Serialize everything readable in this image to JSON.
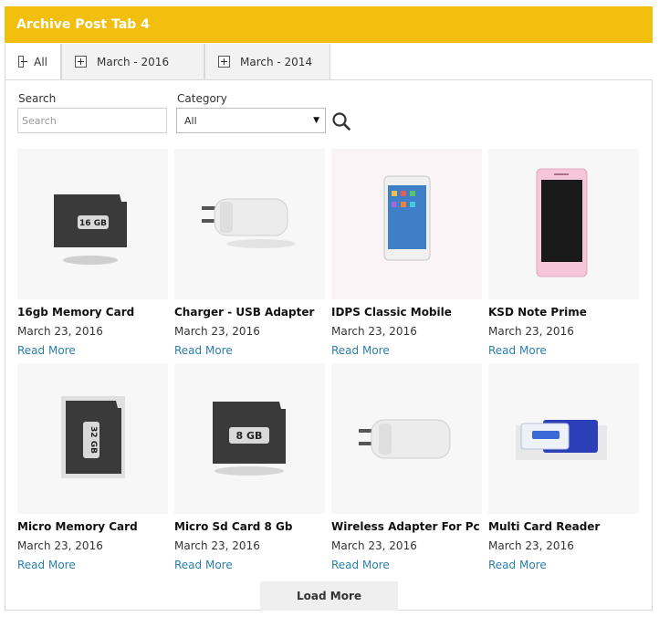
{
  "widget": {
    "title": "Archive Post Tab 4"
  },
  "tabs": [
    {
      "label": "All",
      "state": "expanded"
    },
    {
      "label": "March - 2016",
      "state": "collapsed"
    },
    {
      "label": "March - 2014",
      "state": "collapsed"
    }
  ],
  "filters": {
    "search_label": "Search",
    "search_placeholder": "Search",
    "category_label": "Category",
    "category_value": "All"
  },
  "products": [
    {
      "title": "16gb Memory Card",
      "date": "March 23, 2016",
      "link": "Read More",
      "image": "sd-card-16gb",
      "image_text": "16 GB"
    },
    {
      "title": "Charger - USB Adapter",
      "date": "March 23, 2016",
      "link": "Read More",
      "image": "usb-charger"
    },
    {
      "title": "IDPS Classic Mobile",
      "date": "March 23, 2016",
      "link": "Read More",
      "image": "white-smartphone"
    },
    {
      "title": "KSD Note Prime",
      "date": "March 23, 2016",
      "link": "Read More",
      "image": "pink-smartphone"
    },
    {
      "title": "Micro Memory Card",
      "date": "March 23, 2016",
      "link": "Read More",
      "image": "sd-card-32gb",
      "image_text": "32 GB"
    },
    {
      "title": "Micro Sd Card 8 Gb",
      "date": "March 23, 2016",
      "link": "Read More",
      "image": "sd-card-8gb",
      "image_text": "8 GB"
    },
    {
      "title": "Wireless Adapter For Pc",
      "date": "March 23, 2016",
      "link": "Read More",
      "image": "usb-charger"
    },
    {
      "title": "Multi Card Reader",
      "date": "March 23, 2016",
      "link": "Read More",
      "image": "card-reader"
    }
  ],
  "load_more": "Load More",
  "colors": {
    "header": "#f2bf0f",
    "link": "#2b7ea8"
  }
}
